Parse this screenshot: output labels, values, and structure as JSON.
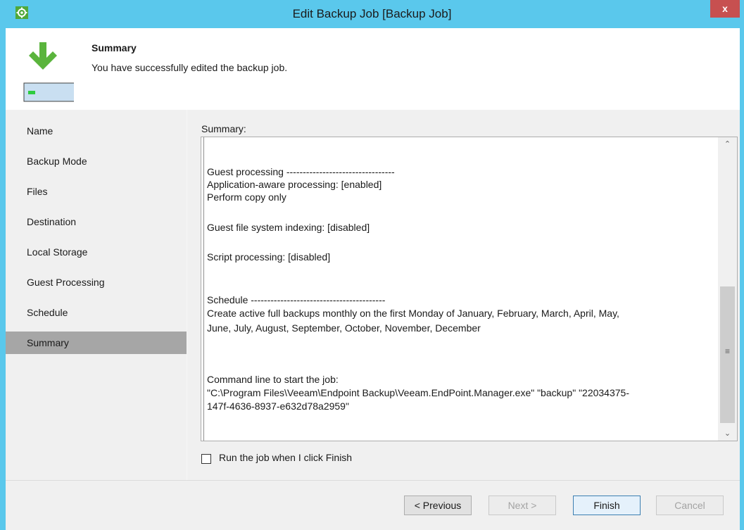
{
  "window": {
    "title": "Edit Backup Job [Backup Job]",
    "close_label": "x"
  },
  "header": {
    "title": "Summary",
    "subtitle": "You have successfully edited the backup job."
  },
  "sidebar": {
    "items": [
      {
        "label": "Name"
      },
      {
        "label": "Backup Mode"
      },
      {
        "label": "Files"
      },
      {
        "label": "Destination"
      },
      {
        "label": "Local Storage"
      },
      {
        "label": "Guest Processing"
      },
      {
        "label": "Schedule"
      },
      {
        "label": "Summary",
        "active": true
      }
    ]
  },
  "summary": {
    "label": "Summary:",
    "lines": [
      "Guest processing ---------------------------------",
      "Application-aware processing: [enabled]",
      "Perform copy only",
      "Guest file system indexing: [disabled]",
      "Script processing: [disabled]",
      "Schedule -----------------------------------------",
      "Create active full backups monthly on the first Monday of January, February, March, April, May,",
      "June, July, August, September, October, November, December",
      "Command line to start the job:",
      "\"C:\\Program Files\\Veeam\\Endpoint Backup\\Veeam.EndPoint.Manager.exe\" \"backup\" \"22034375-",
      "147f-4636-8937-e632d78a2959\""
    ]
  },
  "run_checkbox": {
    "label": "Run the job when I click Finish",
    "checked": false
  },
  "buttons": {
    "previous": "< Previous",
    "next": "Next >",
    "finish": "Finish",
    "cancel": "Cancel"
  },
  "colors": {
    "titlebar": "#5ac8ec",
    "close": "#c75050",
    "selected_nav": "#a6a6a6",
    "icon_arrow": "#5ab43c"
  }
}
